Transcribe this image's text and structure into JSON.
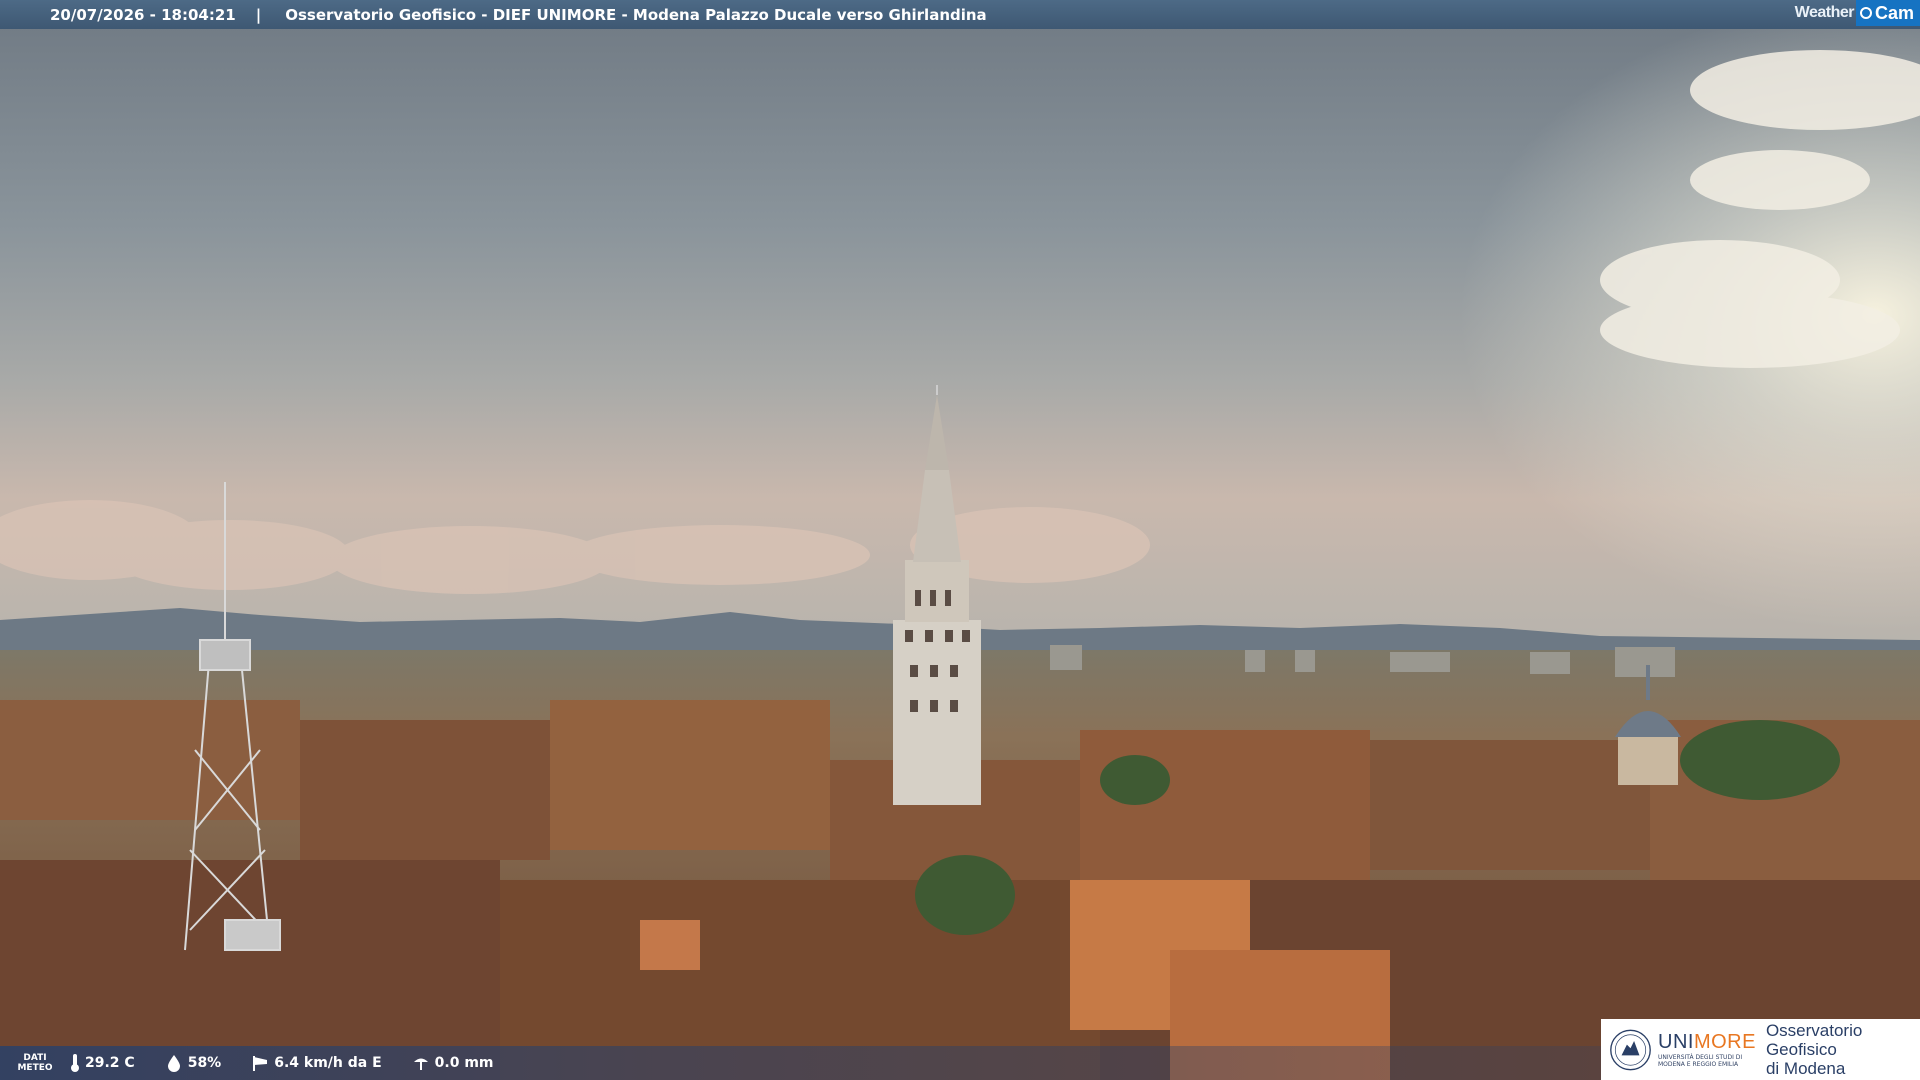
{
  "header": {
    "timestamp": "20/07/2026 - 18:04:21",
    "separator": "|",
    "title": "Osservatorio Geofisico - DIEF UNIMORE - Modena Palazzo Ducale verso Ghirlandina"
  },
  "brand": {
    "logo_left": "Weather",
    "logo_right": "Cam",
    "logo_color": "#1673c2"
  },
  "weather": {
    "label_line1": "DATI",
    "label_line2": "METEO",
    "temperature": "29.2 C",
    "humidity": "58%",
    "wind": "6.4 km/h da E",
    "rain": "0.0 mm",
    "icons": [
      "thermometer-icon",
      "humidity-drop-icon",
      "wind-sock-icon",
      "rain-gauge-icon"
    ]
  },
  "institution": {
    "name_part1": "UNI",
    "name_part2": "MORE",
    "name_sub_line1": "UNIVERSITÀ DEGLI STUDI DI",
    "name_sub_line2": "MODENA E REGGIO EMILIA",
    "observatory_line1": "Osservatorio Geofisico",
    "observatory_line2": "di Modena",
    "brand_color": "#2a3f66",
    "accent_color": "#e87722"
  }
}
